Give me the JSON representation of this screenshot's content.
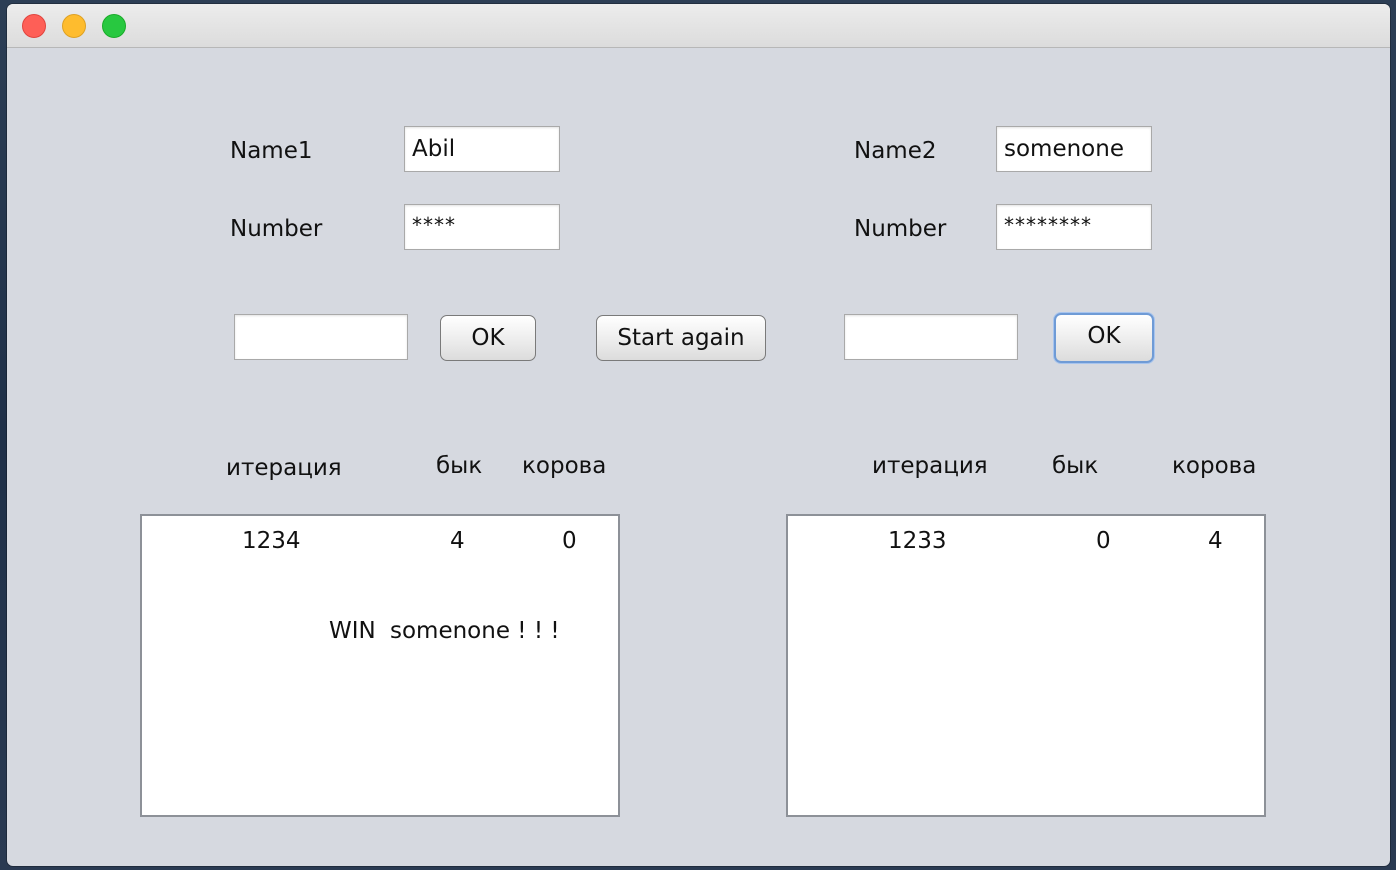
{
  "window": {
    "controls": [
      "close",
      "minimize",
      "zoom"
    ]
  },
  "player1": {
    "name_label": "Name1",
    "name_value": "Abil",
    "number_label": "Number",
    "number_value": "****",
    "guess_value": "",
    "ok_label": "OK"
  },
  "player2": {
    "name_label": "Name2",
    "name_value": "somenone",
    "number_label": "Number",
    "number_value": "********",
    "guess_value": "",
    "ok_label": "OK"
  },
  "start_again_label": "Start again",
  "left_table": {
    "headers": [
      "итерация",
      "бык",
      "корова"
    ],
    "rows": [
      {
        "iteration": "1234",
        "bull": "4",
        "cow": "0"
      }
    ],
    "message_word": "WIN",
    "message_text": "somenone ! ! !"
  },
  "right_table": {
    "headers": [
      "итерация",
      "бык",
      "корова"
    ],
    "rows": [
      {
        "iteration": "1233",
        "bull": "0",
        "cow": "4"
      }
    ]
  }
}
